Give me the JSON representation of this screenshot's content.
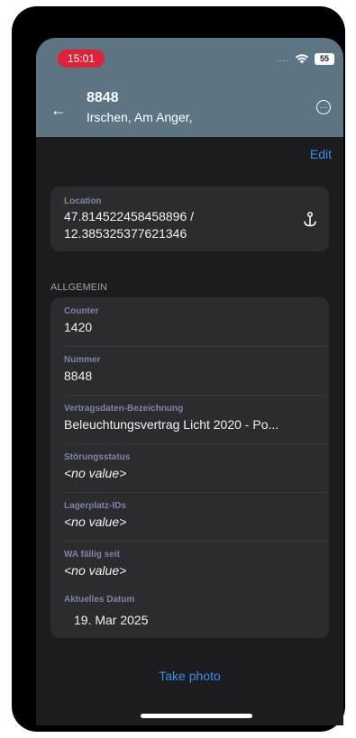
{
  "status_bar": {
    "time": "15:01",
    "signal_dots": "....",
    "battery": "55"
  },
  "header": {
    "back_icon": "arrow-left-icon",
    "title": "8848",
    "subtitle": "Irschen, Am Anger,",
    "more_icon": "ellipsis-circle-icon"
  },
  "toolbar": {
    "edit_label": "Edit"
  },
  "location": {
    "label": "Location",
    "line1": "47.814522458458896 /",
    "line2": "12.385325377621346",
    "icon": "anchor-pin-icon"
  },
  "section": {
    "title": "ALLGEMEIN"
  },
  "fields": [
    {
      "label": "Counter",
      "value": "1420"
    },
    {
      "label": "Nummer",
      "value": "8848"
    },
    {
      "label": "Vertragsdaten-Bezeichnung",
      "value": "Beleuchtungsvertrag Licht 2020 - Po..."
    },
    {
      "label": "Störungsstatus",
      "value": "<no value>"
    },
    {
      "label": "Lagerplatz-IDs",
      "value": "<no value>"
    },
    {
      "label": "WA fällig seit",
      "value": "<no value>"
    }
  ],
  "date_field": {
    "label": "Aktuelles Datum",
    "value": "19. Mar 2025"
  },
  "footer": {
    "take_photo_label": "Take photo"
  },
  "colors": {
    "header_bg": "#5d7583",
    "background": "#1c1c1e",
    "card": "#2c2c2e",
    "accent": "#3d8df0",
    "time_pill": "#e0213a"
  }
}
